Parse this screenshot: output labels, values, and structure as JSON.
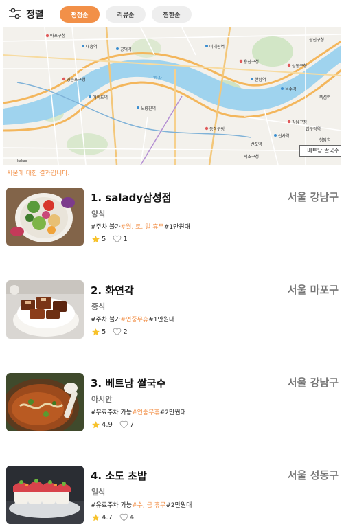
{
  "sort": {
    "title": "정렬",
    "icon": "sliders-icon",
    "options": [
      "평점순",
      "리뷰순",
      "찜한순"
    ],
    "active": "평점순"
  },
  "map": {
    "river_label": "한강",
    "place_labels": [
      "마포구청",
      "용산구청",
      "성동구청",
      "광진구청",
      "동작구청",
      "서초구청",
      "영등포구청",
      "강남구청",
      "대흥역",
      "공덕역",
      "이태원역",
      "한남역",
      "옥수역",
      "뚝섬역",
      "반포역",
      "신사역",
      "압구정역",
      "청담역",
      "여의도역",
      "노량진역"
    ],
    "attribution": "kakao",
    "tag_label": "베트남 쌀국수"
  },
  "result_note": "서울에 대한 결과입니다.",
  "accent_color": "#f29048",
  "restaurants": [
    {
      "name": "1. salady삼성점",
      "region": "서울 강남구",
      "category": "양식",
      "tags_plain": "#주차 불가",
      "tags_hl": "#월, 토, 일 휴무",
      "tags_price": "#1만원대",
      "rating": "5",
      "likes": "1",
      "image": "salad-bowl"
    },
    {
      "name": "2. 화연각",
      "region": "서울 마포구",
      "category": "중식",
      "tags_plain": "#주차 불가",
      "tags_hl": "#연중무휴",
      "tags_price": "#1만원대",
      "rating": "5",
      "likes": "2",
      "image": "braised-pork-dish"
    },
    {
      "name": "3. 베트남 쌀국수",
      "region": "서울 강남구",
      "category": "아시안",
      "tags_plain": "#무료주차 가능",
      "tags_hl": "#연중무휴",
      "tags_price": "#2만원대",
      "rating": "4.9",
      "likes": "7",
      "image": "pho-soup"
    },
    {
      "name": "4. 소도 초밥",
      "region": "서울 성동구",
      "category": "일식",
      "tags_plain": "#유료주차 가능",
      "tags_hl": "#수, 금 휴무",
      "tags_price": "#2만원대",
      "rating": "4.7",
      "likes": "4",
      "image": "sushi-roll"
    }
  ]
}
